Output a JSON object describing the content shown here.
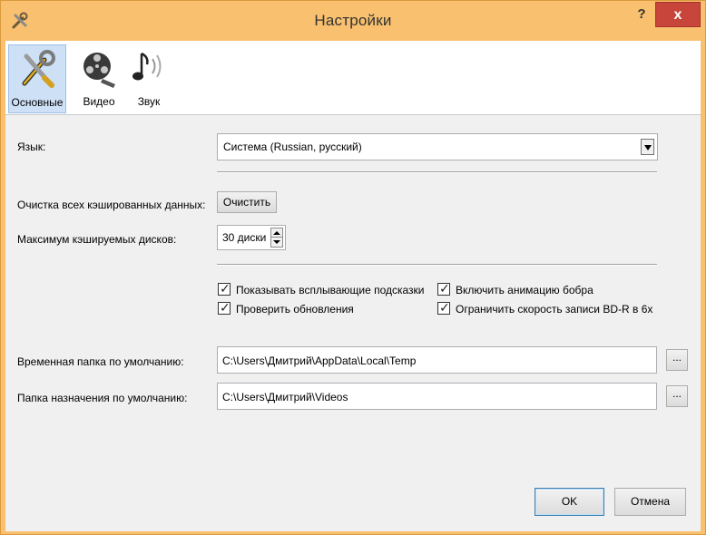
{
  "window": {
    "title": "Настройки",
    "help": "?",
    "close": "x"
  },
  "toolbar": {
    "tabs": [
      {
        "label": "Основные",
        "icon": "tools-icon",
        "active": true
      },
      {
        "label": "Видео",
        "icon": "film-reel-icon",
        "active": false
      },
      {
        "label": "Звук",
        "icon": "music-note-icon",
        "active": false
      }
    ]
  },
  "settings": {
    "language_label": "Язык:",
    "language_value": "Система (Russian, русский)",
    "clear_cache_label": "Очистка всех кэшированных данных:",
    "clear_cache_button": "Очистить",
    "max_cache_label": "Максимум кэшируемых дисков:",
    "max_cache_value": "30 диски",
    "checkboxes": [
      {
        "label": "Показывать всплывающие подсказки",
        "checked": true
      },
      {
        "label": "Включить анимацию бобра",
        "checked": true
      },
      {
        "label": "Проверить обновления",
        "checked": true
      },
      {
        "label": "Ограничить скорость записи BD-R в 6x",
        "checked": true
      }
    ],
    "temp_folder_label": "Временная папка по умолчанию:",
    "temp_folder_value": "C:\\Users\\Дмитрий\\AppData\\Local\\Temp",
    "dest_folder_label": "Папка назначения по умолчанию:",
    "dest_folder_value": "C:\\Users\\Дмитрий\\Videos",
    "browse_label": "..."
  },
  "footer": {
    "ok_label": "OK",
    "cancel_label": "Отмена"
  },
  "colors": {
    "titlebar": "#f8c06f",
    "close": "#c7453a",
    "active_tab": "#cde0f6"
  }
}
